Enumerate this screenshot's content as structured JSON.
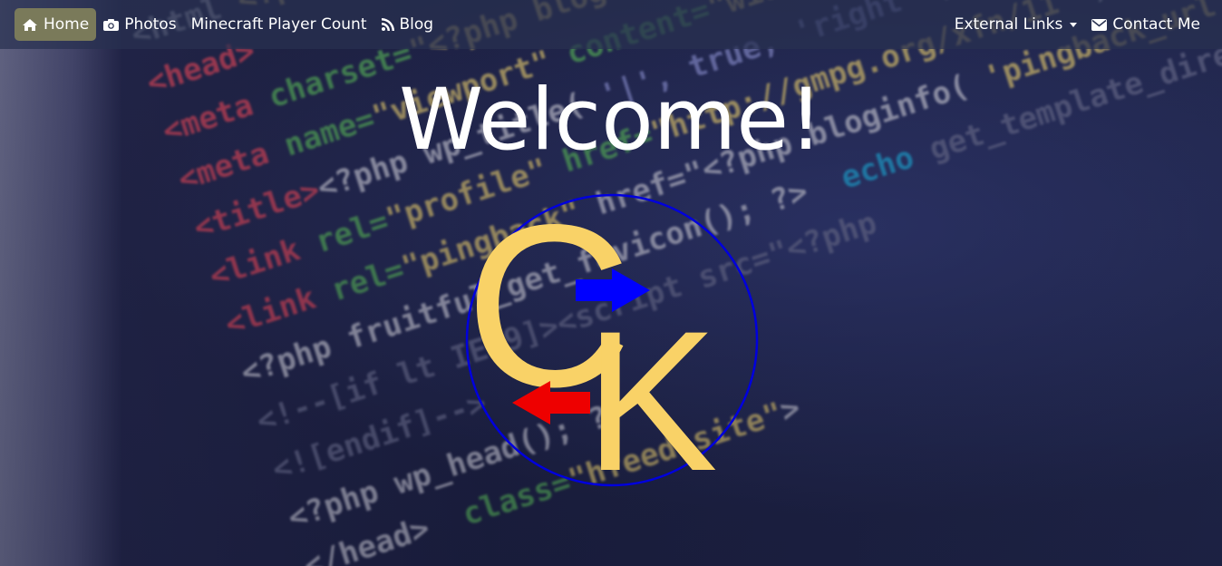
{
  "nav": {
    "home_label": "Home",
    "photos_label": "Photos",
    "minecraft_label": "Minecraft Player Count",
    "blog_label": "Blog",
    "external_label": "External Links",
    "contact_label": "Contact Me"
  },
  "hero": {
    "title": "Welcome!"
  },
  "logo": {
    "letter_c": "C",
    "letter_k": "K",
    "letter_color": "#f9d267",
    "circle_color": "#0000dd",
    "arrow_right_color": "#0000ff",
    "arrow_left_color": "#ee0000"
  },
  "colors": {
    "navbar_bg": "#283050",
    "active_bg": "#7a7a5a"
  },
  "icons": [
    "home-icon",
    "camera-icon",
    "rss-icon",
    "envelope-icon",
    "caret-down-icon"
  ]
}
